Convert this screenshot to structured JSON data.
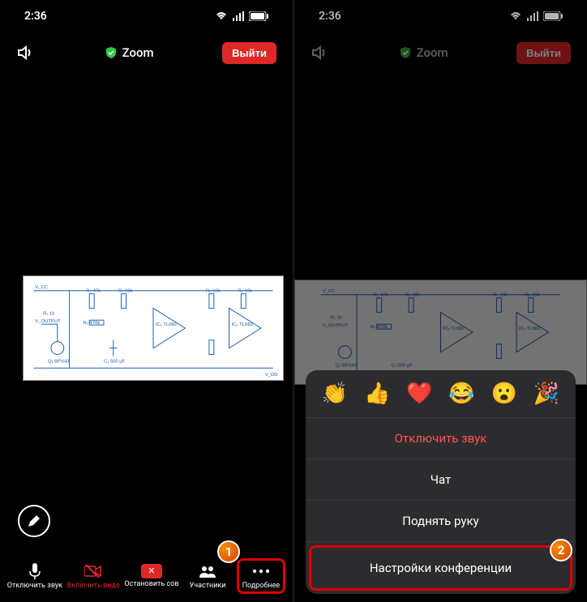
{
  "status": {
    "time": "2:36"
  },
  "topbar": {
    "app": "Zoom",
    "leave": "Выйти"
  },
  "bottombar": {
    "mute": "Отключить звук",
    "video": "Включить виде",
    "share": "Остановить сов",
    "participants": "Участники",
    "more": "Подробнее"
  },
  "menu": {
    "mute": "Отключить звук",
    "chat": "Чат",
    "raise_hand": "Поднять руку",
    "settings": "Настройки конференции"
  },
  "emoji": {
    "clap": "👏",
    "thumbs": "👍",
    "heart": "❤️",
    "laugh": "😂",
    "wow": "😮",
    "party": "🎉"
  },
  "badges": {
    "b1": "1",
    "b2": "2"
  },
  "circuit": {
    "vcc": "V_CC",
    "vout": "V_OUTPUT",
    "vdd": "V_DD",
    "r1": "R₁ 1k",
    "r2": "R₂ 470k",
    "r3": "R₃ 47k",
    "r4": "R₄ 18k",
    "r5": "R₅ 10k",
    "r6": "R₆ 10k",
    "c1": "C₁ 500 μF",
    "ic1": "IC₁ TL082",
    "ic2": "IC₂ TL082",
    "q1": "Q₁ BPX43"
  }
}
